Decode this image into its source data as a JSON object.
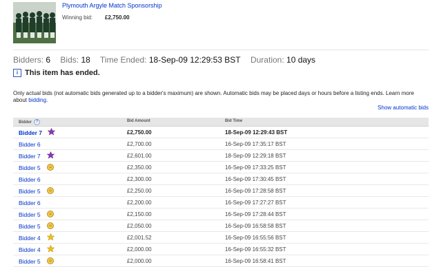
{
  "item": {
    "title": "Plymouth Argyle Match Sponsorship",
    "winning_bid_label": "Winning bid:",
    "winning_bid_value": "£2,750.00"
  },
  "stats": {
    "bidders_label": "Bidders:",
    "bidders_value": "6",
    "bids_label": "Bids:",
    "bids_value": "18",
    "time_ended_label": "Time Ended:",
    "time_ended_value": "18-Sep-09 12:29:53 BST",
    "duration_label": "Duration:",
    "duration_value": "10 days"
  },
  "ended_message": "This item has ended.",
  "note": {
    "text": "Only actual bids (not automatic bids generated up to a bidder's maximum) are shown. Automatic bids may be placed days or hours before a listing ends. Learn more about",
    "link": "bidding",
    "suffix": "."
  },
  "show_automatic_bids": "Show automatic bids",
  "table": {
    "headers": {
      "bidder": "Bidder",
      "amount": "Bid Amount",
      "time": "Bid Time"
    },
    "rows": [
      {
        "bidder": "Bidder 7",
        "amount": "£2,750.00",
        "time": "18-Sep-09 12:29:43 BST",
        "badge": "purple-star"
      },
      {
        "bidder": "Bidder 6",
        "amount": "£2,700.00",
        "time": "16-Sep-09 17:35:17 BST",
        "badge": ""
      },
      {
        "bidder": "Bidder 7",
        "amount": "£2,601.00",
        "time": "18-Sep-09 12:29:18 BST",
        "badge": "purple-star"
      },
      {
        "bidder": "Bidder 5",
        "amount": "£2,350.00",
        "time": "16-Sep-09 17:33:25 BST",
        "badge": "feedback-icon"
      },
      {
        "bidder": "Bidder 6",
        "amount": "£2,300.00",
        "time": "16-Sep-09 17:30:45 BST",
        "badge": ""
      },
      {
        "bidder": "Bidder 5",
        "amount": "£2,250.00",
        "time": "16-Sep-09 17:28:58 BST",
        "badge": "feedback-icon"
      },
      {
        "bidder": "Bidder 6",
        "amount": "£2,200.00",
        "time": "16-Sep-09 17:27:27 BST",
        "badge": ""
      },
      {
        "bidder": "Bidder 5",
        "amount": "£2,150.00",
        "time": "16-Sep-09 17:28:44 BST",
        "badge": "feedback-icon"
      },
      {
        "bidder": "Bidder 5",
        "amount": "£2,050.00",
        "time": "16-Sep-09 16:58:58 BST",
        "badge": "feedback-icon"
      },
      {
        "bidder": "Bidder 4",
        "amount": "£2,001.52",
        "time": "16-Sep-09 16:55:56 BST",
        "badge": "yellow-star"
      },
      {
        "bidder": "Bidder 4",
        "amount": "£2,000.00",
        "time": "16-Sep-09 16:55:32 BST",
        "badge": "yellow-star"
      },
      {
        "bidder": "Bidder 5",
        "amount": "£2,000.00",
        "time": "16-Sep-09 16:58:41 BST",
        "badge": "feedback-icon"
      }
    ]
  },
  "colors": {
    "link": "#0033cc",
    "header_bg": "#e6e6e6",
    "purple_star": "#8a3ab9",
    "yellow_star": "#f2c314"
  }
}
